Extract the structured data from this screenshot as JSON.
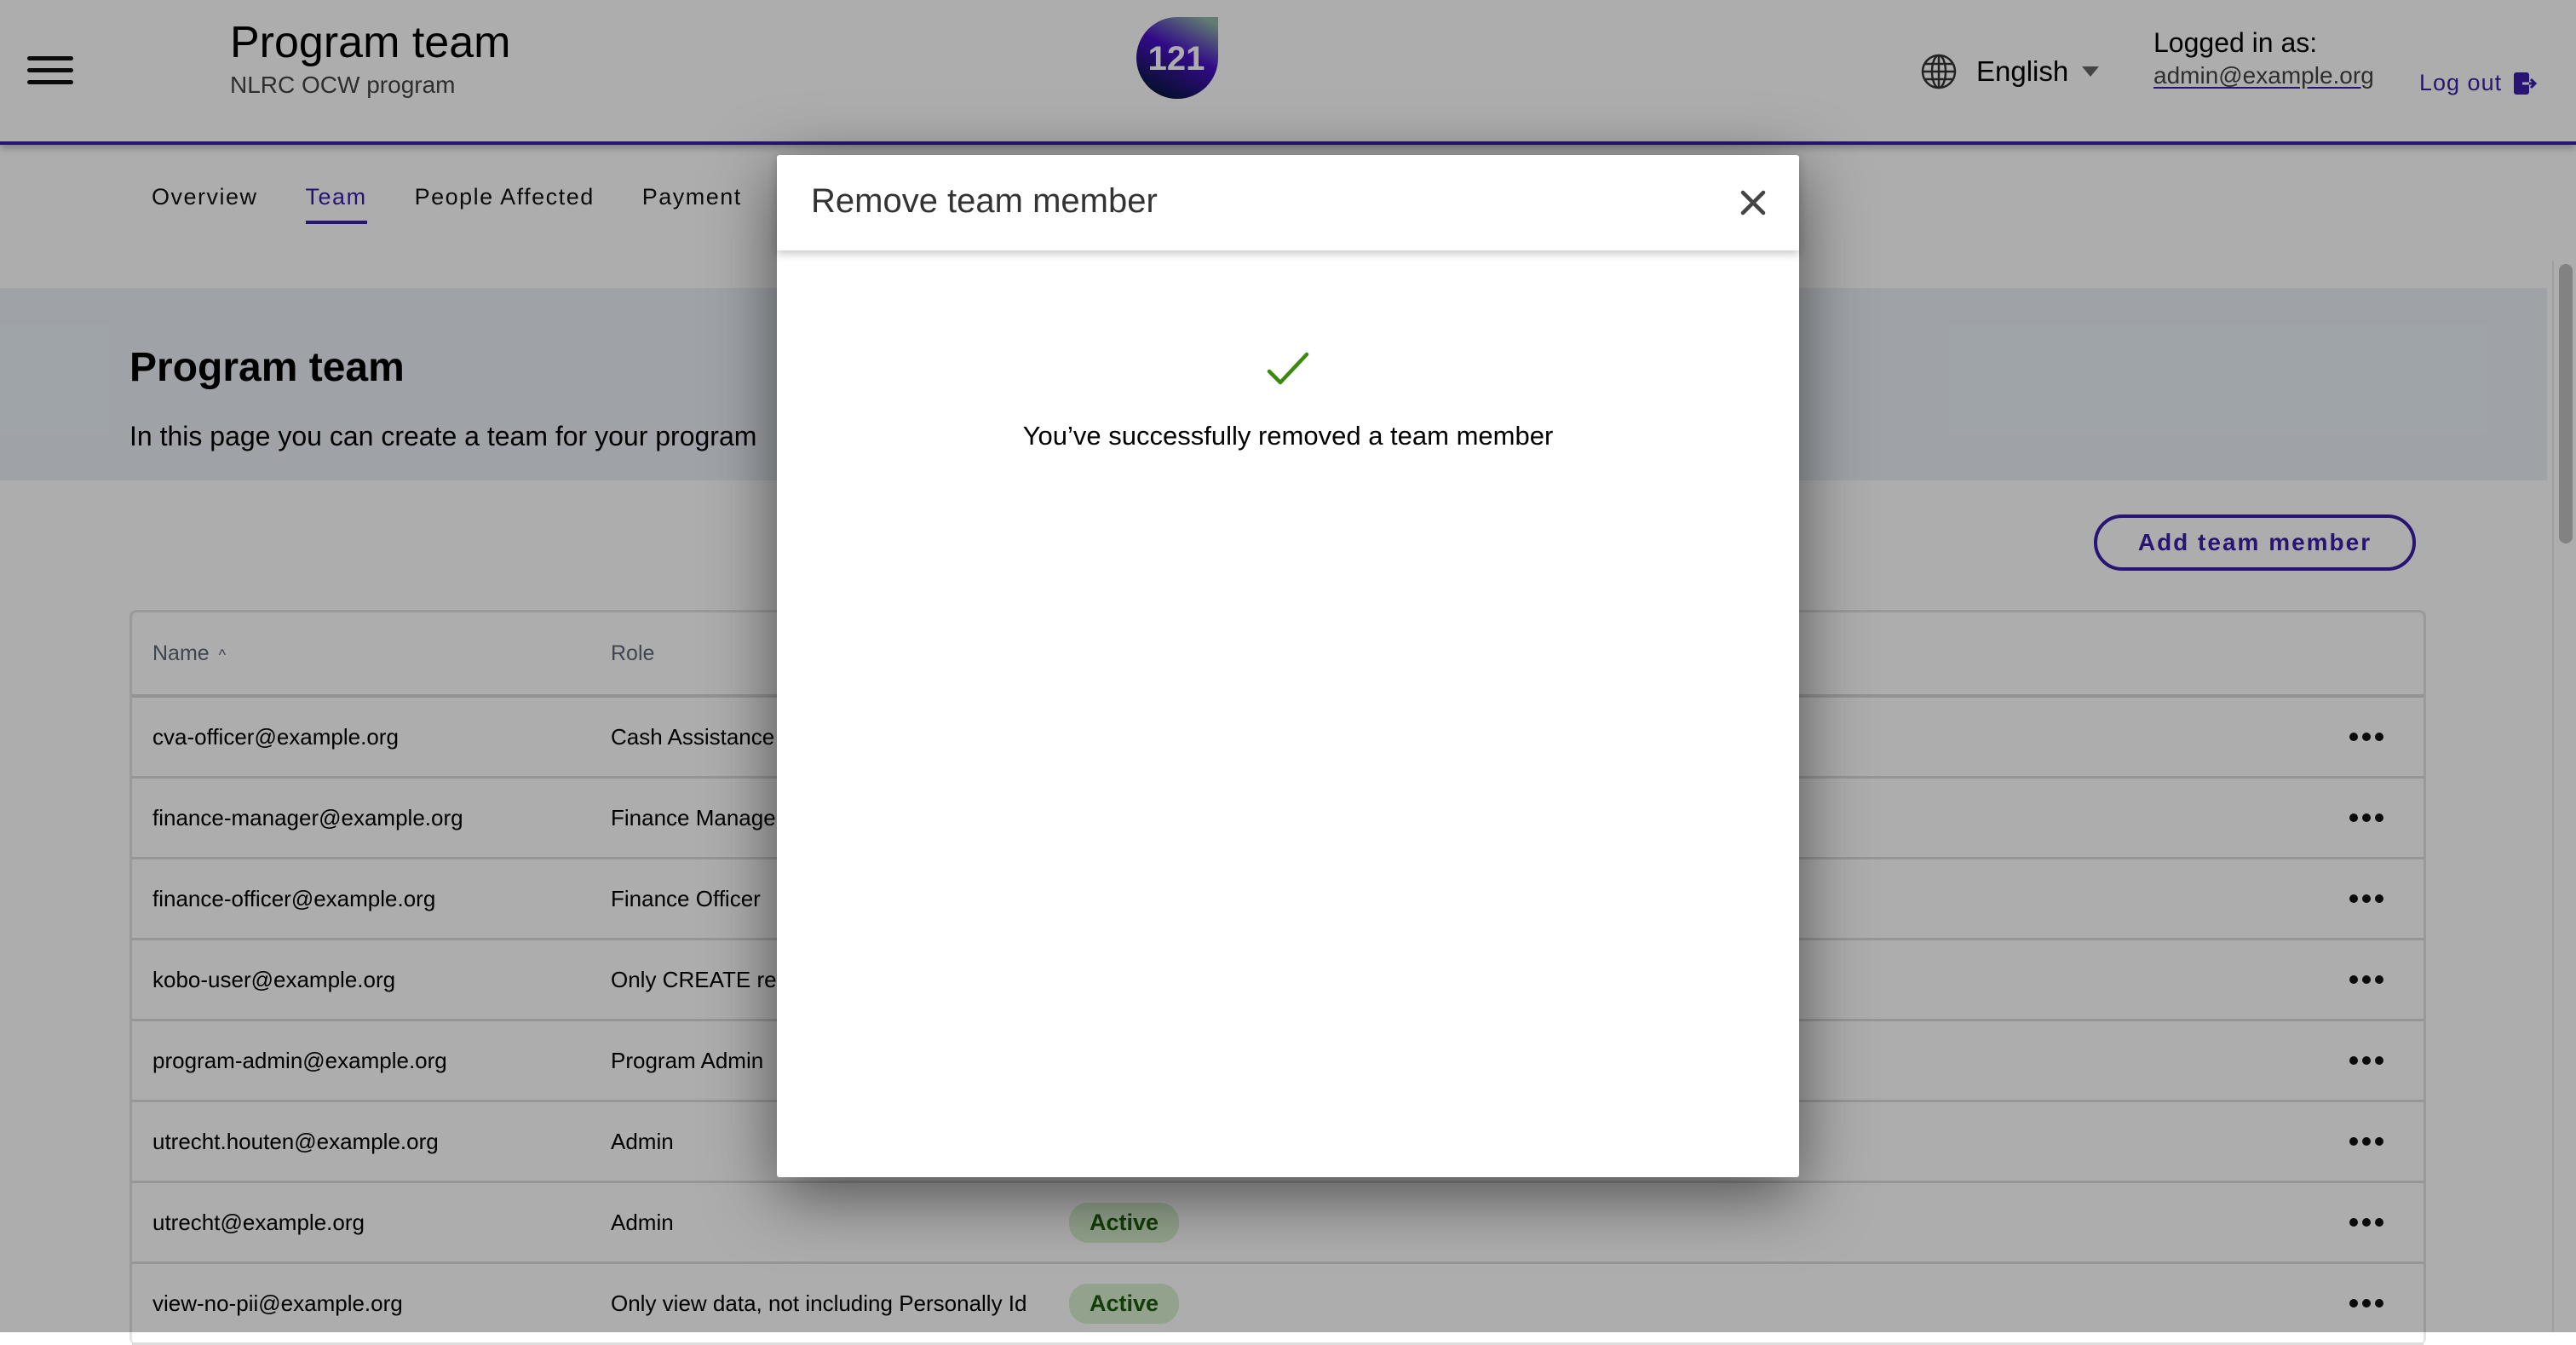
{
  "header": {
    "title": "Program team",
    "subtitle": "NLRC OCW program",
    "logo_text": "121",
    "language": "English",
    "logged_in_label": "Logged in as:",
    "logged_in_email": "admin@example.org",
    "logout_label": "Log out"
  },
  "tabs": [
    {
      "label": "Overview",
      "active": false
    },
    {
      "label": "Team",
      "active": true
    },
    {
      "label": "People Affected",
      "active": false
    },
    {
      "label": "Payment",
      "active": false
    }
  ],
  "banner": {
    "title": "Program team",
    "description": "In this page you can create a team for your program"
  },
  "add_button_label": "Add team member",
  "table": {
    "columns": [
      "Name",
      "Role"
    ],
    "sort_indicator": "^",
    "rows": [
      {
        "name": "cva-officer@example.org",
        "role": "Cash Assistance",
        "status": ""
      },
      {
        "name": "finance-manager@example.org",
        "role": "Finance Manager",
        "status": ""
      },
      {
        "name": "finance-officer@example.org",
        "role": "Finance Officer",
        "status": ""
      },
      {
        "name": "kobo-user@example.org",
        "role": "Only CREATE re",
        "status": ""
      },
      {
        "name": "program-admin@example.org",
        "role": "Program Admin",
        "status": ""
      },
      {
        "name": "utrecht.houten@example.org",
        "role": "Admin",
        "status": ""
      },
      {
        "name": "utrecht@example.org",
        "role": "Admin",
        "status": "Active"
      },
      {
        "name": "view-no-pii@example.org",
        "role": "Only view data, not including Personally Id",
        "status": "Active"
      }
    ]
  },
  "modal": {
    "title": "Remove team member",
    "message": "You’ve successfully removed a team member",
    "icon": "check-icon"
  },
  "colors": {
    "brand": "#3b1eaa",
    "success": "#3a8a0e",
    "badge_bg": "#d7efcf",
    "badge_text": "#1d5a0c"
  }
}
